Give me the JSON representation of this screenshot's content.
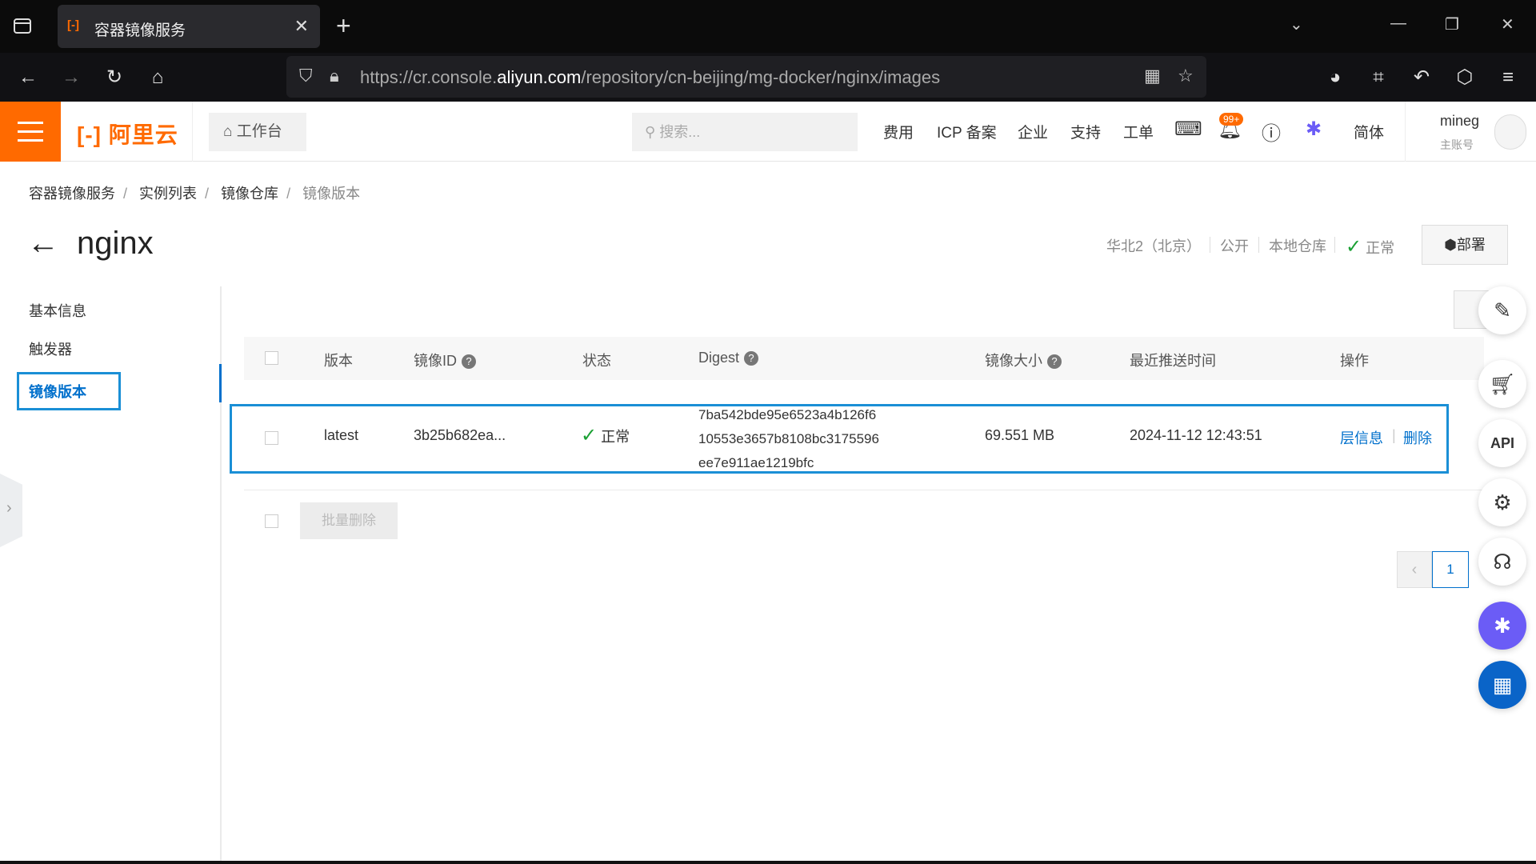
{
  "browser": {
    "tab_title": "容器镜像服务",
    "url_prefix": "https://cr.console.",
    "url_domain": "aliyun.com",
    "url_path": "/repository/cn-beijing/mg-docker/nginx/images"
  },
  "header": {
    "logo": "阿里云",
    "workbench": "工作台",
    "search_placeholder": "搜索...",
    "nav": [
      "费用",
      "ICP 备案",
      "企业",
      "支持",
      "工单"
    ],
    "badge": "99+",
    "lang": "简体",
    "user_name": "mineg",
    "user_role": "主账号"
  },
  "breadcrumb": [
    "容器镜像服务",
    "实例列表",
    "镜像仓库",
    "镜像版本"
  ],
  "page": {
    "title": "nginx",
    "region": "华北2（北京）",
    "visibility": "公开",
    "repo_type": "本地仓库",
    "status": "正常",
    "deploy": "部署"
  },
  "sidebar": [
    "基本信息",
    "触发器",
    "镜像版本"
  ],
  "table": {
    "headers": [
      "版本",
      "镜像ID",
      "状态",
      "Digest",
      "镜像大小",
      "最近推送时间",
      "操作"
    ],
    "rows": [
      {
        "version": "latest",
        "image_id": "3b25b682ea...",
        "status": "正常",
        "digest": [
          "7ba542bde95e6523a4b126f6",
          "10553e3657b8108bc3175596",
          "ee7e911ae1219bfc"
        ],
        "size": "69.551 MB",
        "pushed": "2024-11-12 12:43:51",
        "actions": [
          "层信息",
          "删除"
        ]
      }
    ],
    "batch_delete": "批量删除",
    "page": "1"
  },
  "colors": {
    "brand": "#ff6a00",
    "link": "#0070cc",
    "ok": "#1aa033"
  }
}
